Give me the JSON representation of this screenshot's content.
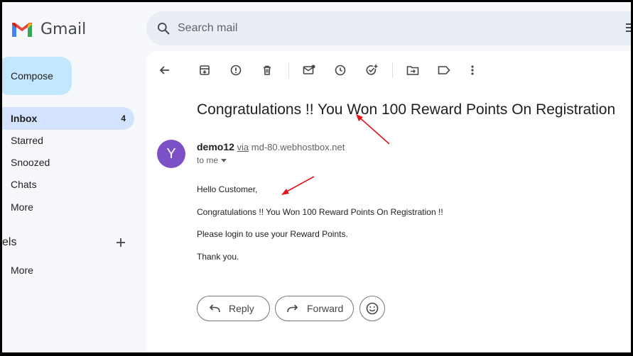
{
  "app": {
    "name": "Gmail"
  },
  "search": {
    "placeholder": "Search mail"
  },
  "compose": {
    "label": "Compose"
  },
  "sidebar": {
    "items": [
      {
        "label": "Inbox",
        "count": "4"
      },
      {
        "label": "Starred"
      },
      {
        "label": "Snoozed"
      },
      {
        "label": "Chats"
      },
      {
        "label": "More"
      }
    ],
    "labels_heading": "els",
    "labels_more": "More"
  },
  "email": {
    "subject": "Congratulations !! You Won 100 Reward Points On Registration",
    "sender_name": "demo12",
    "via_label": "via",
    "via_domain": "md-80.webhostbox.net",
    "recipient": "to me",
    "avatar_letter": "Y",
    "avatar_color": "#7b51c5",
    "body": [
      "Hello Customer,",
      "Congratulations !! You Won 100 Reward Points On Registration !!",
      "Please login to use your Reward Points.",
      "Thank you."
    ]
  },
  "actions": {
    "reply": "Reply",
    "forward": "Forward"
  },
  "annotation_color": "#e0141b"
}
